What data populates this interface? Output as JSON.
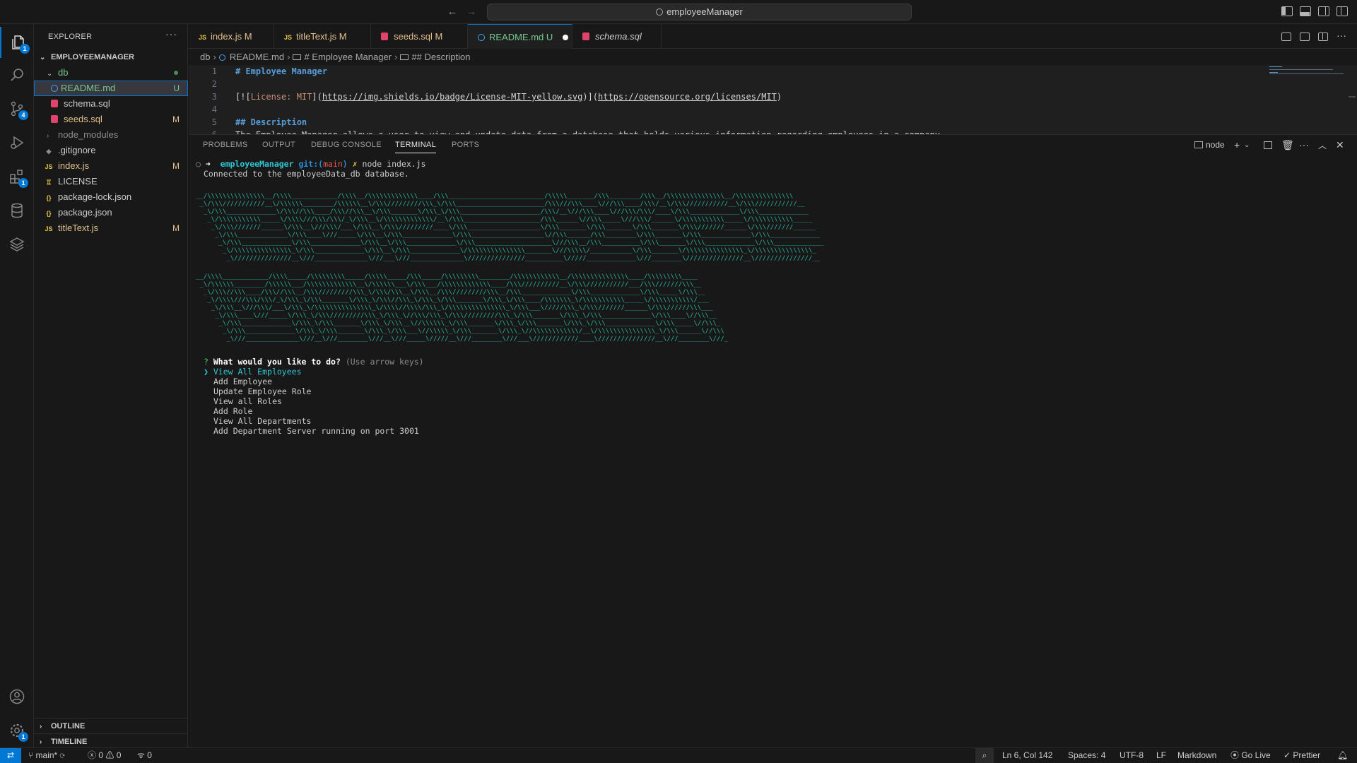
{
  "titlebar": {
    "search_text": "employeeManager"
  },
  "activity": {
    "explorer_badge": "1",
    "scm_badge": "4",
    "extensions_badge": "1",
    "settings_badge": "1"
  },
  "sidebar": {
    "title": "EXPLORER",
    "more": "···",
    "project": "EMPLOYEEMANAGER",
    "tree": {
      "db": "db",
      "readme": "README.md",
      "readme_mark": "U",
      "schema": "schema.sql",
      "seeds": "seeds.sql",
      "seeds_mark": "M",
      "node_modules": "node_modules",
      "gitignore": ".gitignore",
      "indexjs": "index.js",
      "indexjs_mark": "M",
      "license": "LICENSE",
      "packagelock": "package-lock.json",
      "package": "package.json",
      "titletext": "titleText.js",
      "titletext_mark": "M"
    },
    "outline": "OUTLINE",
    "timeline": "TIMELINE"
  },
  "tabs": [
    {
      "label": "index.js",
      "mark": "M"
    },
    {
      "label": "titleText.js",
      "mark": "M"
    },
    {
      "label": "seeds.sql",
      "mark": "M"
    },
    {
      "label": "README.md",
      "mark": "U"
    },
    {
      "label": "schema.sql",
      "mark": ""
    }
  ],
  "breadcrumb": {
    "root": "db",
    "file": "README.md",
    "h1": "# Employee Manager",
    "h2": "## Description"
  },
  "code": {
    "line_numbers": [
      "1",
      "2",
      "3",
      "4",
      "5",
      "6"
    ],
    "l1": "# Employee Manager",
    "l3_a": "[![",
    "l3_b": "License: MIT",
    "l3_c": "](",
    "l3_d": "https://img.shields.io/badge/License-MIT-yellow.svg",
    "l3_e": ")](",
    "l3_f": "https://opensource.org/licenses/MIT",
    "l3_g": ")",
    "l5": "## Description",
    "l6": "The Employee Manager allows a user to view and update data from a database that holds various information regarding employees in a company."
  },
  "panel": {
    "tabs": [
      "PROBLEMS",
      "OUTPUT",
      "DEBUG CONSOLE",
      "TERMINAL",
      "PORTS"
    ],
    "terminal_name": "node"
  },
  "terminal": {
    "prompt_arrow": "➜",
    "dir": "employeeManager",
    "git_label": "git:(",
    "branch": "main",
    "git_close": ")",
    "dirty": "✗",
    "command": "node index.js",
    "connected": "Connected to the employeeData_db database.",
    "ascii_title_1": [
      "__/\\\\\\\\\\\\\\\\\\\\\\\\\\\\\\__/\\\\\\\\____________/\\\\\\\\__/\\\\\\\\\\\\\\\\\\\\\\\\\\____/\\\\\\_________________________/\\\\\\\\\\_______/\\\\\\________/\\\\\\__/\\\\\\\\\\\\\\\\\\\\\\\\\\\\\\__/\\\\\\\\\\\\\\\\\\\\\\\\\\\\\\",
      " _\\/\\\\\\///////////__\\/\\\\\\\\\\\\________/\\\\\\\\\\\\__\\/\\\\\\/////////\\\\\\_\\/\\\\\\_______________________/\\\\\\///\\\\\\____\\///\\\\\\____/\\\\\\/__\\/\\\\\\///////////__\\/\\\\\\///////////__",
      "  _\\/\\\\\\_____________\\/\\\\\\//\\\\\\____/\\\\\\//\\\\\\__\\/\\\\\\_______\\/\\\\\\_\\/\\\\\\_____________________/\\\\\\/__\\///\\\\\\____\\///\\\\\\/\\\\\\/____\\/\\\\\\_____________\\/\\\\\\_____________",
      "   _\\/\\\\\\\\\\\\\\\\\\\\\\_____\\/\\\\\\\\///\\\\\\/\\\\\\/_\\/\\\\\\__\\/\\\\\\\\\\\\\\\\\\\\\\\\\\/__\\/\\\\\\____________________/\\\\\\______\\//\\\\\\_____\\///\\\\\\/______\\/\\\\\\\\\\\\\\\\\\\\\\_____\\/\\\\\\\\\\\\\\\\\\\\\\_____",
      "    _\\/\\\\\\///////______\\/\\\\\\__\\///\\\\\\/___\\/\\\\\\__\\/\\\\\\/////////____\\/\\\\\\___________________\\/\\\\\\_______\\/\\\\\\_______\\/\\\\\\_______\\/\\\\\\///////______\\/\\\\\\///////______",
      "     _\\/\\\\\\_____________\\/\\\\\\____\\///_____\\/\\\\\\__\\/\\\\\\_____________\\/\\\\\\___________________\\//\\\\\\______/\\\\\\________\\/\\\\\\_______\\/\\\\\\_____________\\/\\\\\\_____________",
      "      _\\/\\\\\\_____________\\/\\\\\\_____________\\/\\\\\\__\\/\\\\\\_____________\\/\\\\\\____________________\\///\\\\\\__/\\\\\\__________\\/\\\\\\_______\\/\\\\\\_____________\\/\\\\\\_____________",
      "       _\\/\\\\\\\\\\\\\\\\\\\\\\\\\\\\\\_\\/\\\\\\_____________\\/\\\\\\__\\/\\\\\\_____________\\/\\\\\\\\\\\\\\\\\\\\\\\\\\\\\\_______\\///\\\\\\\\\\/___________\\/\\\\\\_______\\/\\\\\\\\\\\\\\\\\\\\\\\\\\\\\\_\\/\\\\\\\\\\\\\\\\\\\\\\\\\\\\\\_",
      "        _\\///////////////__\\///______________\\///___\\///______________\\///////////////__________\\/////_____________\\///________\\///////////////__\\///////////////__"
    ],
    "ascii_title_2": [
      "__/\\\\\\\\____________/\\\\\\\\_____/\\\\\\\\\\\\\\\\\\_____/\\\\\\\\\\_____/\\\\\\_____/\\\\\\\\\\\\\\\\\\________/\\\\\\\\\\\\\\\\\\\\\\\\__/\\\\\\\\\\\\\\\\\\\\\\\\\\\\\\____/\\\\\\\\\\\\\\\\\\____",
      " _\\/\\\\\\\\\\\\________/\\\\\\\\\\\\___/\\\\\\\\\\\\\\\\\\\\\\\\\\__\\/\\\\\\\\\\\\___\\/\\\\\\___/\\\\\\\\\\\\\\\\\\\\\\\\\\____/\\\\\\//////////__\\/\\\\\\///////////___/\\\\\\///////\\\\\\__",
      "  _\\/\\\\\\//\\\\\\____/\\\\\\//\\\\\\__/\\\\\\/////////\\\\\\_\\/\\\\\\/\\\\\\__\\/\\\\\\__/\\\\\\/////////\\\\\\__/\\\\\\_____________\\/\\\\\\_____________\\/\\\\\\_____\\/\\\\\\__",
      "   _\\/\\\\\\\\///\\\\\\/\\\\\\/_\\/\\\\\\_\\/\\\\\\_______\\/\\\\\\_\\/\\\\\\//\\\\\\_\\/\\\\\\_\\/\\\\\\_______\\/\\\\\\_\\/\\\\\\____/\\\\\\\\\\\\\\_\\/\\\\\\\\\\\\\\\\\\\\\\_____\\/\\\\\\\\\\\\\\\\\\\\\\/___",
      "    _\\/\\\\\\__\\///\\\\\\/___\\/\\\\\\_\\/\\\\\\\\\\\\\\\\\\\\\\\\\\\\\\_\\/\\\\\\\\//\\\\\\\\/\\\\\\_\\/\\\\\\\\\\\\\\\\\\\\\\\\\\\\\\_\\/\\\\\\___\\/////\\\\\\_\\/\\\\\\///////______\\/\\\\\\//////\\\\\\___",
      "     _\\/\\\\\\____\\///_____\\/\\\\\\_\\/\\\\\\/////////\\\\\\_\\/\\\\\\_\\//\\\\\\/\\\\\\_\\/\\\\\\/////////\\\\\\_\\/\\\\\\_______\\/\\\\\\_\\/\\\\\\_____________\\/\\\\\\____\\//\\\\\\__",
      "      _\\/\\\\\\_____________\\/\\\\\\_\\/\\\\\\_______\\/\\\\\\_\\/\\\\\\__\\//\\\\\\\\\\\\_\\/\\\\\\_______\\/\\\\\\_\\/\\\\\\_______\\/\\\\\\_\\/\\\\\\_____________\\/\\\\\\_____\\//\\\\\\_",
      "       _\\/\\\\\\_____________\\/\\\\\\_\\/\\\\\\_______\\/\\\\\\_\\/\\\\\\___\\//\\\\\\\\\\_\\/\\\\\\_______\\/\\\\\\_\\//\\\\\\\\\\\\\\\\\\\\\\\\/__\\/\\\\\\\\\\\\\\\\\\\\\\\\\\\\\\_\\/\\\\\\______\\//\\\\\\",
      "        _\\///______________\\///__\\///________\\///__\\///_____\\/////__\\///________\\///___\\////////////____\\///////////////__\\///________\\///_"
    ],
    "question_mark": "?",
    "question": "What would you like to do?",
    "hint": "(Use arrow keys)",
    "pointer": "❯",
    "options": [
      "View All Employees",
      "Add Employee",
      "Update Employee Role",
      "View all Roles",
      "Add Role",
      "View All Departments",
      "Add Department Server running on port 3001"
    ]
  },
  "statusbar": {
    "remote": "⇄",
    "branch": "main*",
    "errors": "0",
    "warnings": "0",
    "ports": "0",
    "position": "Ln 6, Col 142",
    "spaces": "Spaces: 4",
    "encoding": "UTF-8",
    "eol": "LF",
    "language": "Markdown",
    "golive": "Go Live",
    "prettier": "Prettier"
  }
}
